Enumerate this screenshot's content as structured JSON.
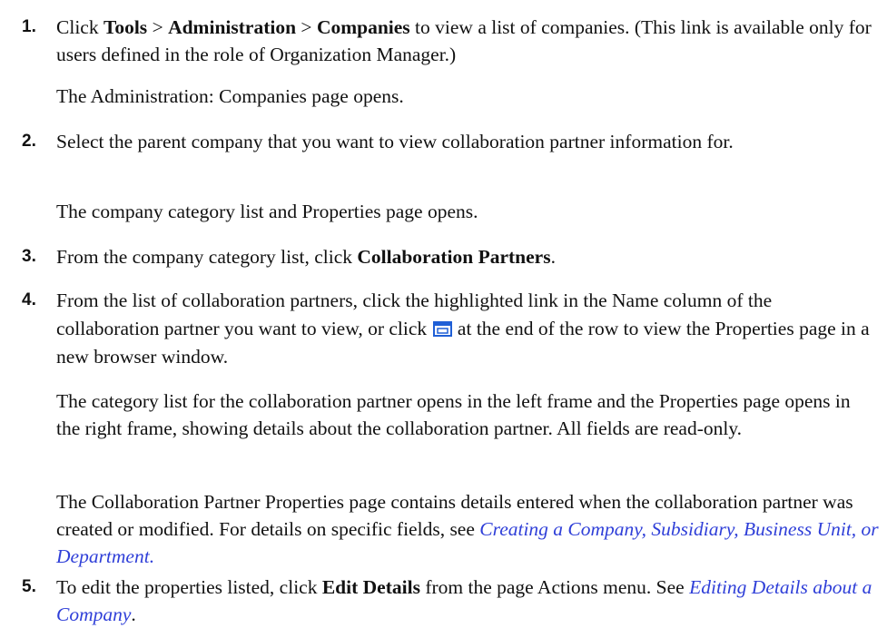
{
  "steps": [
    {
      "number": "1.",
      "instruction": {
        "t1": "Click ",
        "b1": "Tools",
        "t2": " > ",
        "b2": "Administration",
        "t3": " > ",
        "b3": "Companies",
        "t4": " to view a list of companies. (This link is available only for users defined in the role of Organization Manager.)"
      },
      "result": "The Administration: Companies page opens."
    },
    {
      "number": "2.",
      "instruction": {
        "t1": "Select the parent company that you want to view collaboration partner information for."
      },
      "result": "The company category list and Properties page opens."
    },
    {
      "number": "3.",
      "instruction": {
        "t1": "From the company category list, click ",
        "b1": "Collaboration Partners",
        "t2": "."
      }
    },
    {
      "number": "4.",
      "instruction": {
        "t1": "From the list of collaboration partners, click the highlighted link in the Name column of the collaboration partner you want to view, or click ",
        "icon": "new-window-icon",
        "t2": " at the end of the row to view the Properties page in a new browser window."
      },
      "result": "The category list for the collaboration partner opens in the left frame and the Properties page opens in the right frame, showing details about the collaboration partner. All fields are read-only.",
      "note": {
        "t1": "The Collaboration Partner Properties page contains details entered when the collaboration partner was created or modified. For details on specific fields, see ",
        "link": "Creating a Company, Subsidiary, Business Unit, or Department."
      }
    },
    {
      "number": "5.",
      "instruction": {
        "t1": "To edit the properties listed, click ",
        "b1": "Edit Details",
        "t2": " from the page Actions menu. See ",
        "link": "Editing Details about a Company",
        "t3": "."
      }
    }
  ],
  "colors": {
    "text": "#111111",
    "link": "#2f3fd8",
    "icon": "#1f5fd6"
  }
}
